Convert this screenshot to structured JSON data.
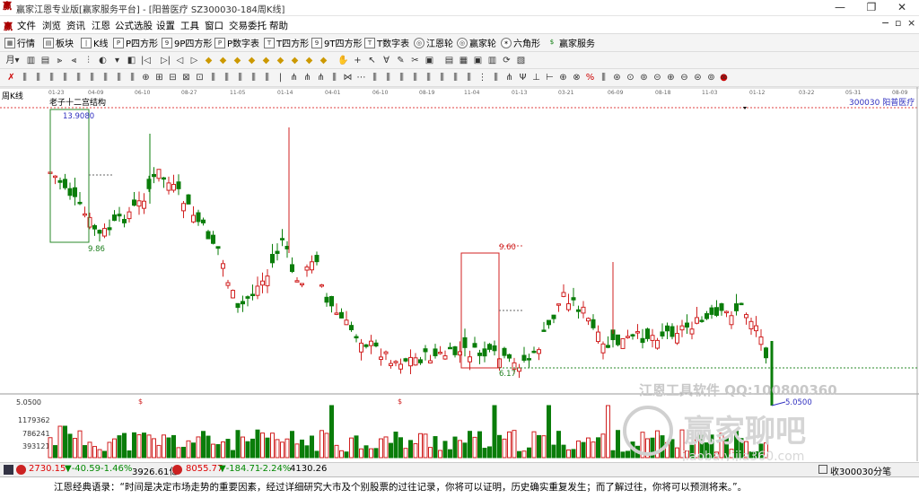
{
  "window": {
    "title": "赢家江恩专业版[赢家服务平台] - [阳普医疗  SZ300030-184周K线]",
    "app_icon": "赢",
    "minimize": "—",
    "restore": "❐",
    "close": "✕"
  },
  "menu": {
    "items": [
      "文件",
      "浏览",
      "资讯",
      "江恩",
      "公式选股",
      "设置",
      "工具",
      "窗口",
      "交易委托",
      "帮助"
    ],
    "ctl_min": "−",
    "ctl_restore": "▫",
    "ctl_close": "×"
  },
  "toolbar1": {
    "items": [
      "行情",
      "板块",
      "K线",
      "P四方形",
      "9P四方形",
      "P数字表",
      "T四方形",
      "9T四方形",
      "T数字表",
      "江恩轮",
      "赢家轮",
      "六角形",
      "赢家服务"
    ],
    "icons": [
      "grid-icon",
      "blocks-icon",
      "candle-icon",
      "P",
      "9P",
      "PN",
      "T",
      "9T",
      "TN",
      "wheel",
      "wheel",
      "hex",
      "$"
    ]
  },
  "toolbar2": {
    "period": "月",
    "icons": [
      "period-dropdown",
      "bar-tool",
      "bar-tool",
      "bar-tool",
      "bar-tool",
      "bar-tool",
      "bar-tool",
      "bar-tool",
      "bar-tool",
      "bar-tool",
      "bar-tool",
      "bar-tool"
    ]
  },
  "chart": {
    "period_label": "周K线",
    "structure_label": "老子十二宫结构",
    "stock_label": "300030  阳普医疗",
    "dates": [
      "01-23",
      "04-09",
      "06-10",
      "08-27",
      "11-05",
      "01-14",
      "04-01",
      "06-10",
      "08-19",
      "11-04",
      "01-13",
      "03-21",
      "06-09",
      "08-18",
      "11-03",
      "01-12",
      "03-22",
      "05-31",
      "08-09"
    ],
    "annotations": {
      "high1": "13.9080",
      "low1": "9.86",
      "high2": "9.60",
      "low2": "6.17",
      "last": "5.0500"
    },
    "volume": {
      "levels": [
        "1179362",
        "786241",
        "393121"
      ],
      "price_marker": "5.0500",
      "event_marks": [
        "$",
        "$"
      ]
    },
    "watermark": {
      "line1": "江恩工具软件  QQ:100800360",
      "line2": "赢家聊吧",
      "line3": "jiaoba.yijia360.com"
    },
    "colors": {
      "up": "#d02020",
      "down": "#0a7d0a",
      "box1": "#2a8a2a",
      "box2": "#d02020",
      "dashed": "#2a8a2a"
    }
  },
  "status": {
    "index1": "2730.15",
    "index1_change": "▼-40.59",
    "index1_pct": "-1.46%",
    "index1_amount": "3926.61亿",
    "index2": "8055.77",
    "index2_change": "▼-184.71",
    "index2_pct": "-2.24%",
    "index2_amount": "4130.26",
    "right": "收300030分笔"
  },
  "quote": "江恩经典语录：“时间是决定市场走势的重要因素，经过详细研究大市及个别股票的过往记录，你将可以证明，历史确实重复发生；而了解过往，你将可以预测将来。”。"
}
